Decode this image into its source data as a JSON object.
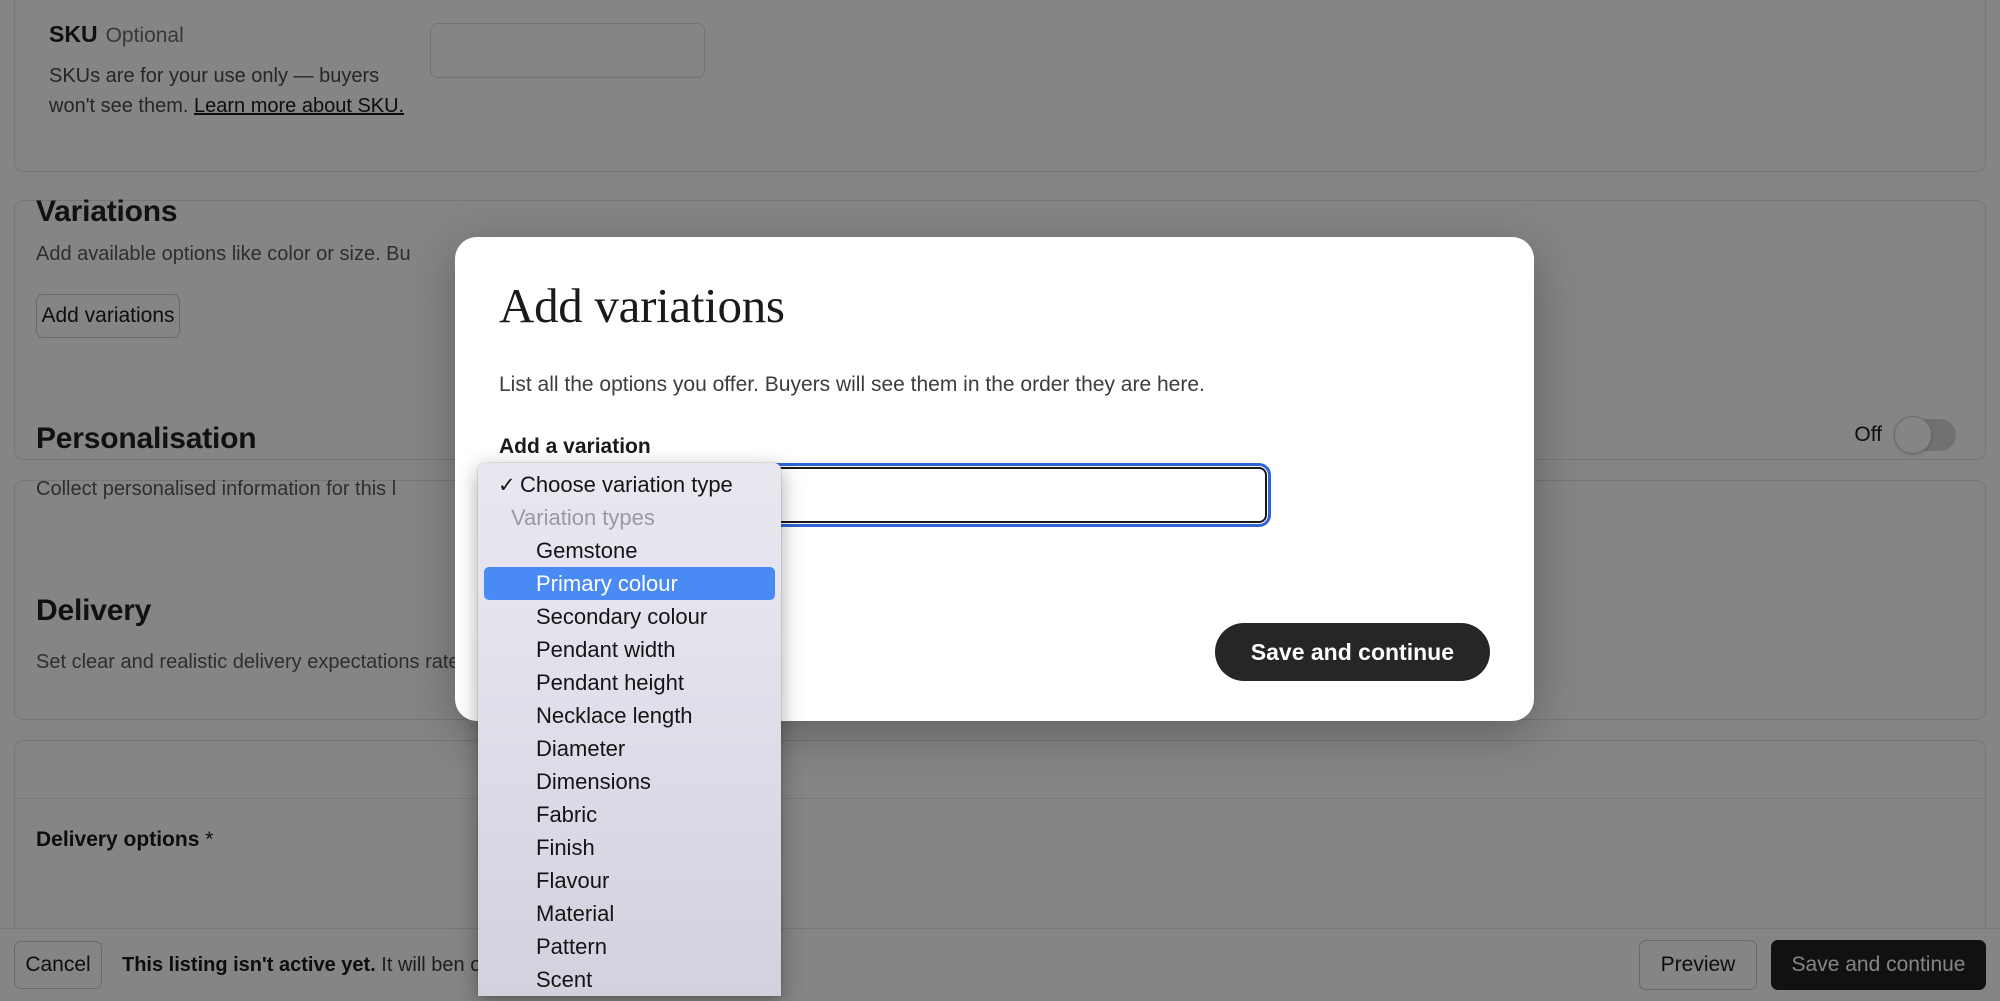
{
  "page": {
    "sku": {
      "label": "SKU",
      "optional": "Optional",
      "help_before": "SKUs are for your use only — buyers won't see them. ",
      "help_link": "Learn more about SKU.",
      "input_value": ""
    },
    "variations": {
      "title": "Variations",
      "description": "Add available options like color or size. Bu",
      "add_button": "Add variations"
    },
    "personalisation": {
      "title": "Personalisation",
      "description": "Collect personalised information for this l",
      "toggle_label": "Off",
      "toggle_state": "off"
    },
    "delivery": {
      "title": "Delivery",
      "description_before": "Set clear and realistic delivery expectations ",
      "description_after": "rate processing time.",
      "options_label": "Delivery options",
      "required_marker": "*"
    }
  },
  "bottom_bar": {
    "cancel": "Cancel",
    "status_bold": "This listing isn't active yet.",
    "status_rest_before": " It will be",
    "status_rest_after": "n open your shop.",
    "preview": "Preview",
    "save": "Save and continue"
  },
  "modal": {
    "title": "Add variations",
    "description": "List all the options you offer. Buyers will see them in the order they are here.",
    "field_label": "Add a variation",
    "select_value": "",
    "save_button": "Save and continue"
  },
  "dropdown": {
    "checkmark": "✓",
    "selected_index": 2,
    "items": [
      {
        "label": "Choose variation type",
        "type": "option",
        "checked": true
      },
      {
        "label": "Variation types",
        "type": "group"
      },
      {
        "label": "Gemstone",
        "type": "option"
      },
      {
        "label": "Primary colour",
        "type": "option",
        "selected": true
      },
      {
        "label": "Secondary colour",
        "type": "option"
      },
      {
        "label": "Pendant width",
        "type": "option"
      },
      {
        "label": "Pendant height",
        "type": "option"
      },
      {
        "label": "Necklace length",
        "type": "option"
      },
      {
        "label": "Diameter",
        "type": "option"
      },
      {
        "label": "Dimensions",
        "type": "option"
      },
      {
        "label": "Fabric",
        "type": "option"
      },
      {
        "label": "Finish",
        "type": "option"
      },
      {
        "label": "Flavour",
        "type": "option"
      },
      {
        "label": "Material",
        "type": "option"
      },
      {
        "label": "Pattern",
        "type": "option"
      },
      {
        "label": "Scent",
        "type": "option"
      }
    ]
  },
  "colors": {
    "accent_selection": "#4a8af4",
    "focus_ring": "#3063d5",
    "dark_button": "#262626",
    "scrim": "rgba(0,0,0,0.48)"
  }
}
